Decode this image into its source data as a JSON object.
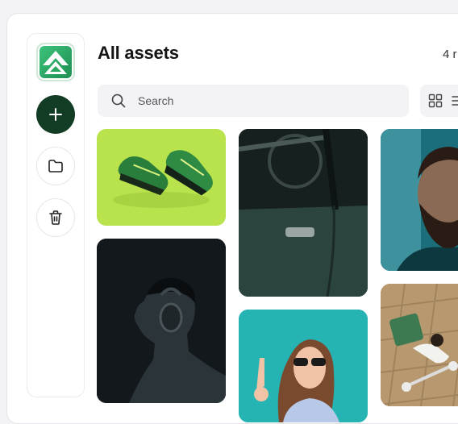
{
  "header": {
    "title": "All assets",
    "count_text": "4 r"
  },
  "search": {
    "placeholder": "Search"
  },
  "sidebar": {
    "items": [
      {
        "name": "add",
        "icon": "plus-icon"
      },
      {
        "name": "folders",
        "icon": "folder-icon"
      },
      {
        "name": "trash",
        "icon": "trash-icon"
      }
    ]
  },
  "assets": [
    {
      "subject": "green running shoes",
      "bg": "#b4e04a"
    },
    {
      "subject": "vintage car door",
      "bg": "#1c2a28"
    },
    {
      "subject": "bearded man portrait",
      "bg": "#0f4f57"
    },
    {
      "subject": "man with headphones",
      "bg": "#141a1e"
    },
    {
      "subject": "woman with sunglasses",
      "bg": "#27b3b2"
    },
    {
      "subject": "delivery rider on scooter",
      "bg": "#b69a76"
    }
  ],
  "colors": {
    "accent": "#123d24",
    "logo_green": "#2aa861"
  }
}
